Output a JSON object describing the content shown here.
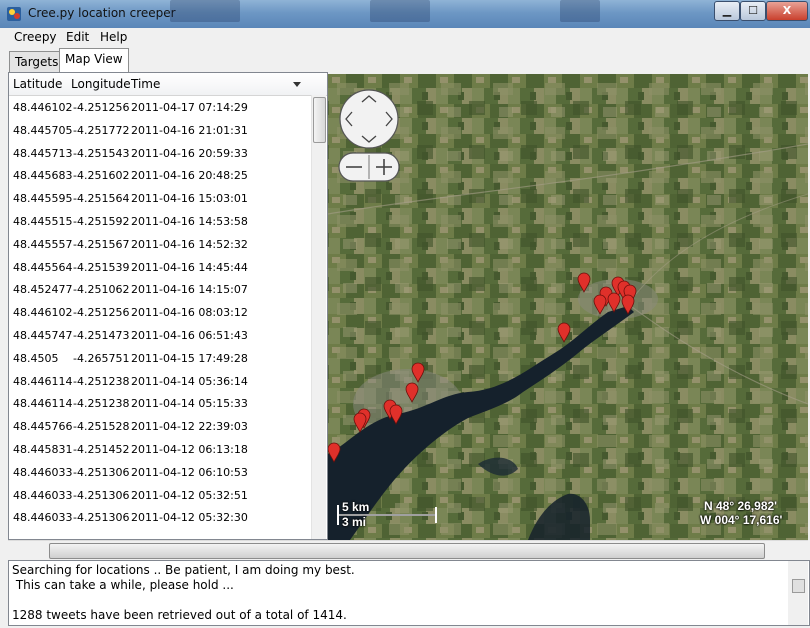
{
  "window": {
    "title": "Cree.py location creeper",
    "min_label": "▁",
    "max_label": "☐",
    "close_label": "X"
  },
  "menu": {
    "items": [
      "Creepy",
      "Edit",
      "Help"
    ]
  },
  "tabs": [
    "Targets",
    "Map View"
  ],
  "table": {
    "headers": [
      "Latitude",
      "Longitude",
      "Time"
    ],
    "rows": [
      [
        "48.446102",
        "-4.251256",
        "2011-04-17 07:14:29"
      ],
      [
        "48.445705",
        "-4.251772",
        "2011-04-16 21:01:31"
      ],
      [
        "48.445713",
        "-4.251543",
        "2011-04-16 20:59:33"
      ],
      [
        "48.445683",
        "-4.251602",
        "2011-04-16 20:48:25"
      ],
      [
        "48.445595",
        "-4.251564",
        "2011-04-16 15:03:01"
      ],
      [
        "48.445515",
        "-4.251592",
        "2011-04-16 14:53:58"
      ],
      [
        "48.445557",
        "-4.251567",
        "2011-04-16 14:52:32"
      ],
      [
        "48.445564",
        "-4.251539",
        "2011-04-16 14:45:44"
      ],
      [
        "48.452477",
        "-4.251062",
        "2011-04-16 14:15:07"
      ],
      [
        "48.446102",
        "-4.251256",
        "2011-04-16 08:03:12"
      ],
      [
        "48.445747",
        "-4.251473",
        "2011-04-16 06:51:43"
      ],
      [
        "48.4505",
        "-4.265751",
        "2011-04-15 17:49:28"
      ],
      [
        "48.446114",
        "-4.251238",
        "2011-04-14 05:36:14"
      ],
      [
        "48.446114",
        "-4.251238",
        "2011-04-14 05:15:33"
      ],
      [
        "48.445766",
        "-4.251528",
        "2011-04-12 22:39:03"
      ],
      [
        "48.445831",
        "-4.251452",
        "2011-04-12 06:13:18"
      ],
      [
        "48.446033",
        "-4.251306",
        "2011-04-12 06:10:53"
      ],
      [
        "48.446033",
        "-4.251306",
        "2011-04-12 05:32:51"
      ],
      [
        "48.446033",
        "-4.251306",
        "2011-04-12 05:32:30"
      ]
    ]
  },
  "map": {
    "scale_km": "5 km",
    "scale_mi": "3 mi",
    "coord_lat": "N 48° 26,982'",
    "coord_lon": "W 004° 17,616'"
  },
  "log": {
    "lines": [
      "Searching for locations .. Be patient, I am doing my best.",
      " This can take a while, please hold ...",
      "",
      "1288 tweets have been retrieved out of a total of 1414."
    ]
  },
  "colors": {
    "marker": "#e0302a",
    "water": "#15212c",
    "land": "#5c6e3e"
  }
}
